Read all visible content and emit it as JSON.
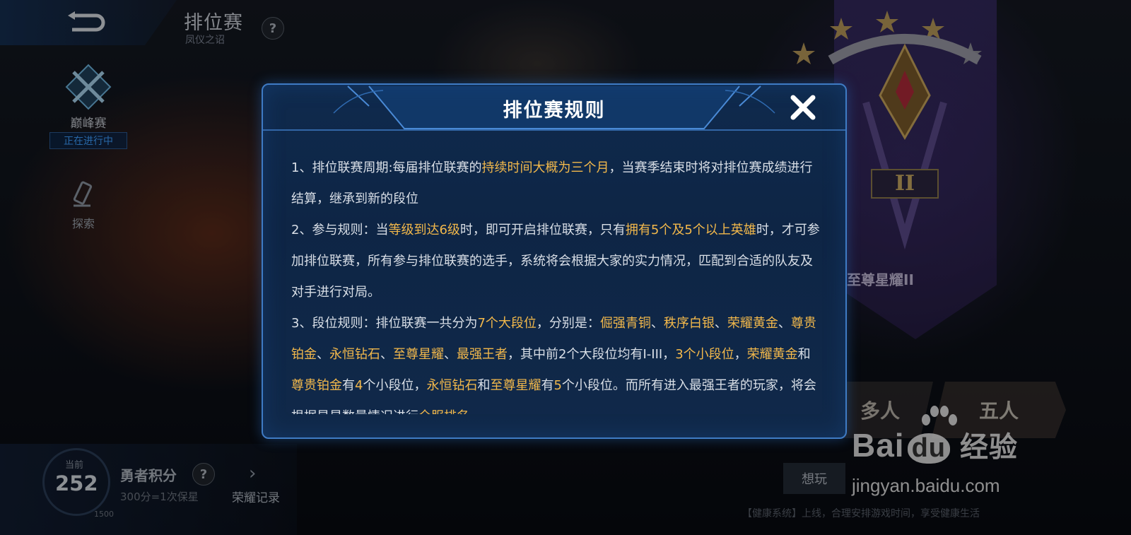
{
  "header": {
    "title": "排位赛",
    "subtitle": "凤仪之诏",
    "help": "?"
  },
  "nav": {
    "peak": {
      "label": "巅峰赛",
      "status": "正在进行中"
    },
    "explore": {
      "label": "探索"
    }
  },
  "score": {
    "current_label": "当前",
    "value": "252",
    "max": "1500",
    "brave_label": "勇者积分",
    "brave_help": "?",
    "brave_sub": "300分=1次保星",
    "honor_label": "荣耀记录",
    "honor_icon": "›"
  },
  "rank": {
    "name": "至尊星耀II",
    "tier_numeral": "II"
  },
  "modes": {
    "multi": "多人",
    "five": "五人"
  },
  "want_label": "想玩",
  "health_note": "【健康系统】上线，合理安排游戏时间，享受健康生活",
  "watermark": {
    "logo_a": "Bai",
    "logo_du": "du",
    "logo_b": "经验",
    "url": "jingyan.baidu.com"
  },
  "dialog": {
    "title": "排位赛规则",
    "close_icon": "close-icon",
    "rules": [
      [
        {
          "t": "1、排位联赛周期:每届排位联赛的",
          "h": false
        },
        {
          "t": "持续时间大概为三个月",
          "h": true
        },
        {
          "t": "，当赛季结束时将对排位赛成绩进行结算，继承到新的段位",
          "h": false
        }
      ],
      [
        {
          "t": "2、参与规则：当",
          "h": false
        },
        {
          "t": "等级到达6级",
          "h": true
        },
        {
          "t": "时，即可开启排位联赛，只有",
          "h": false
        },
        {
          "t": "拥有5个及5个以上英雄",
          "h": true
        },
        {
          "t": "时，才可参加排位联赛，所有参与排位联赛的选手，系统将会根据大家的实力情况，匹配到合适的队友及对手进行对局。",
          "h": false
        }
      ],
      [
        {
          "t": "3、段位规则：排位联赛一共分为",
          "h": false
        },
        {
          "t": "7个大段位",
          "h": true
        },
        {
          "t": "，分别是：",
          "h": false
        },
        {
          "t": "倔强青铜",
          "h": true
        },
        {
          "t": "、",
          "h": false
        },
        {
          "t": "秩序白银",
          "h": true
        },
        {
          "t": "、",
          "h": false
        },
        {
          "t": "荣耀黄金",
          "h": true
        },
        {
          "t": "、",
          "h": false
        },
        {
          "t": "尊贵铂金",
          "h": true
        },
        {
          "t": "、",
          "h": false
        },
        {
          "t": "永恒钻石",
          "h": true
        },
        {
          "t": "、",
          "h": false
        },
        {
          "t": "至尊星耀",
          "h": true
        },
        {
          "t": "、",
          "h": false
        },
        {
          "t": "最强王者",
          "h": true
        },
        {
          "t": "，其中前2个大段位均有I-III，",
          "h": false
        },
        {
          "t": "3个小段位",
          "h": true
        },
        {
          "t": "，",
          "h": false
        },
        {
          "t": "荣耀黄金",
          "h": true
        },
        {
          "t": "和",
          "h": false
        },
        {
          "t": "尊贵铂金",
          "h": true
        },
        {
          "t": "有",
          "h": false
        },
        {
          "t": "4",
          "h": true
        },
        {
          "t": "个小段位，",
          "h": false
        },
        {
          "t": "永恒钻石",
          "h": true
        },
        {
          "t": "和",
          "h": false
        },
        {
          "t": "至尊星耀",
          "h": true
        },
        {
          "t": "有",
          "h": false
        },
        {
          "t": "5",
          "h": true
        },
        {
          "t": "个小段位。而所有进入最强王者的玩家，将会根据星星数量情况进行",
          "h": false
        },
        {
          "t": "全服排名",
          "h": true
        }
      ]
    ]
  },
  "colors": {
    "highlight": "#f2b84b",
    "dialog_border": "#3f7bc4",
    "dialog_bg": "#0f2a4d"
  }
}
